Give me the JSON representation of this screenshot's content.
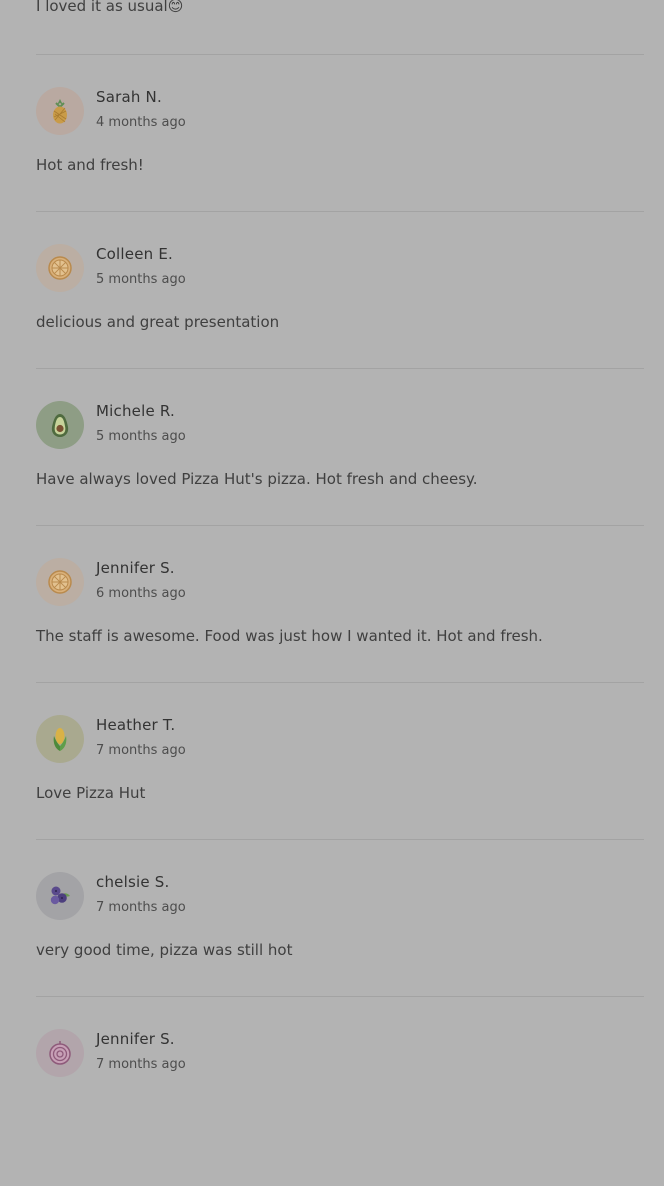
{
  "top_review_text": "I loved it as usual😊",
  "reviews": [
    {
      "name": "Sarah N.",
      "time": "4 months ago",
      "text": "Hot and fresh!",
      "avatar_icon": "pineapple-icon",
      "avatar_bg": "#b9a9a1"
    },
    {
      "name": "Colleen E.",
      "time": "5 months ago",
      "text": "delicious and great presentation",
      "avatar_icon": "orange-slice-icon",
      "avatar_bg": "#bbaea3"
    },
    {
      "name": "Michele R.",
      "time": "5 months ago",
      "text": "Have always loved Pizza Hut's pizza. Hot fresh and cheesy.",
      "avatar_icon": "avocado-icon",
      "avatar_bg": "#8e9d85"
    },
    {
      "name": "Jennifer S.",
      "time": "6 months ago",
      "text": "The staff is awesome. Food was just how I wanted it. Hot and fresh.",
      "avatar_icon": "orange-slice-icon",
      "avatar_bg": "#bbaea3"
    },
    {
      "name": "Heather T.",
      "time": "7 months ago",
      "text": "Love Pizza Hut",
      "avatar_icon": "corn-icon",
      "avatar_bg": "#a9a98f"
    },
    {
      "name": "chelsie S.",
      "time": "7 months ago",
      "text": "very good time, pizza was still hot",
      "avatar_icon": "blueberries-icon",
      "avatar_bg": "#a3a3a6"
    },
    {
      "name": "Jennifer S.",
      "time": "7 months ago",
      "text": "",
      "avatar_icon": "onion-icon",
      "avatar_bg": "#b2a5ab"
    }
  ]
}
